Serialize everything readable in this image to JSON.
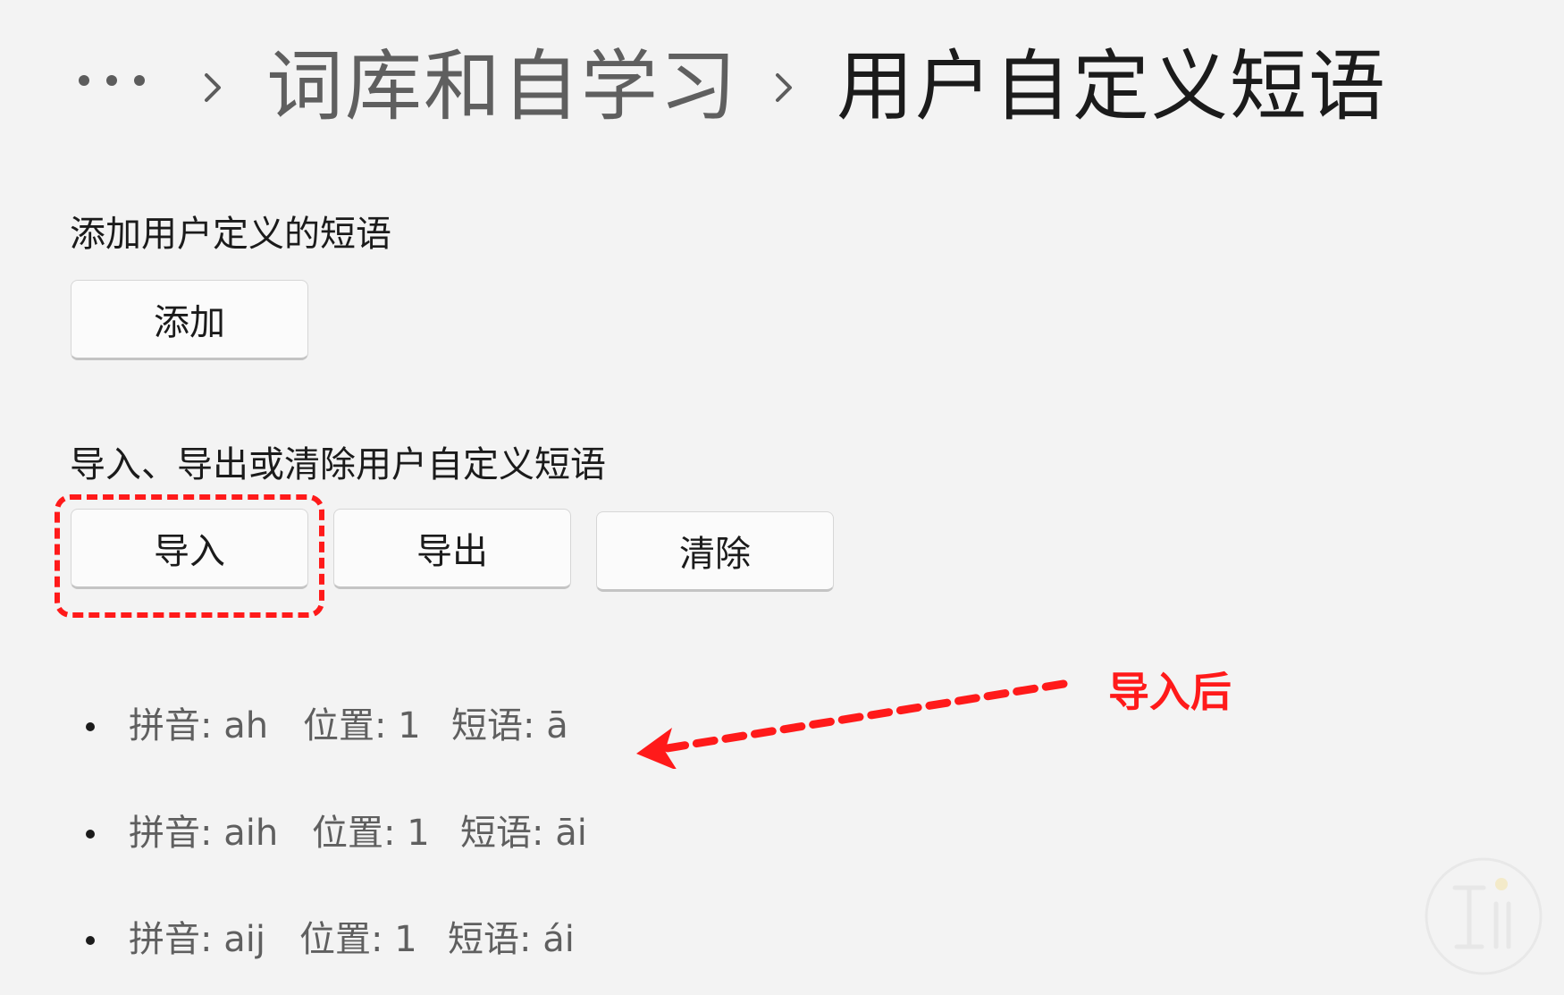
{
  "breadcrumb": {
    "more_icon": "more-horizontal-icon",
    "separator_icon": "chevron-right-icon",
    "parent": "词库和自学习",
    "current": "用户自定义短语"
  },
  "add_section": {
    "label": "添加用户定义的短语",
    "add_button": "添加"
  },
  "io_section": {
    "label": "导入、导出或清除用户自定义短语",
    "import_button": "导入",
    "export_button": "导出",
    "clear_button": "清除"
  },
  "annotation": {
    "text": "导入后",
    "color": "#ff1a1a"
  },
  "phrases": [
    {
      "pinyin_label": "拼音: ah",
      "position_label": "位置: 1",
      "phrase_label": "短语: ā"
    },
    {
      "pinyin_label": "拼音: aih",
      "position_label": "位置: 1",
      "phrase_label": "短语: āi"
    },
    {
      "pinyin_label": "拼音: aij",
      "position_label": "位置: 1",
      "phrase_label": "短语: ái"
    }
  ],
  "colors": {
    "background": "#f3f3f3",
    "highlight": "#ff1a1a"
  }
}
